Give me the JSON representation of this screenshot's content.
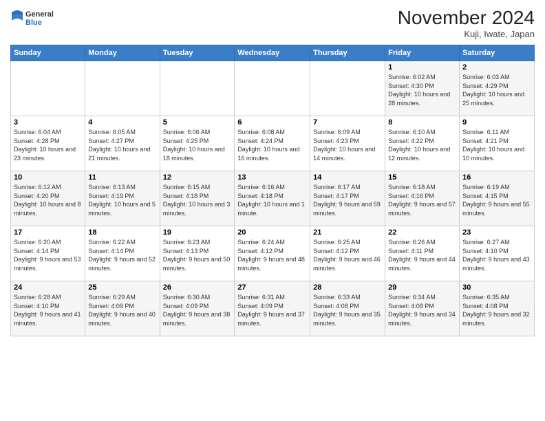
{
  "logo": {
    "general": "General",
    "blue": "Blue"
  },
  "header": {
    "title": "November 2024",
    "location": "Kuji, Iwate, Japan"
  },
  "days_of_week": [
    "Sunday",
    "Monday",
    "Tuesday",
    "Wednesday",
    "Thursday",
    "Friday",
    "Saturday"
  ],
  "weeks": [
    [
      {
        "day": "",
        "info": ""
      },
      {
        "day": "",
        "info": ""
      },
      {
        "day": "",
        "info": ""
      },
      {
        "day": "",
        "info": ""
      },
      {
        "day": "",
        "info": ""
      },
      {
        "day": "1",
        "info": "Sunrise: 6:02 AM\nSunset: 4:30 PM\nDaylight: 10 hours and 28 minutes."
      },
      {
        "day": "2",
        "info": "Sunrise: 6:03 AM\nSunset: 4:29 PM\nDaylight: 10 hours and 25 minutes."
      }
    ],
    [
      {
        "day": "3",
        "info": "Sunrise: 6:04 AM\nSunset: 4:28 PM\nDaylight: 10 hours and 23 minutes."
      },
      {
        "day": "4",
        "info": "Sunrise: 6:05 AM\nSunset: 4:27 PM\nDaylight: 10 hours and 21 minutes."
      },
      {
        "day": "5",
        "info": "Sunrise: 6:06 AM\nSunset: 4:25 PM\nDaylight: 10 hours and 18 minutes."
      },
      {
        "day": "6",
        "info": "Sunrise: 6:08 AM\nSunset: 4:24 PM\nDaylight: 10 hours and 16 minutes."
      },
      {
        "day": "7",
        "info": "Sunrise: 6:09 AM\nSunset: 4:23 PM\nDaylight: 10 hours and 14 minutes."
      },
      {
        "day": "8",
        "info": "Sunrise: 6:10 AM\nSunset: 4:22 PM\nDaylight: 10 hours and 12 minutes."
      },
      {
        "day": "9",
        "info": "Sunrise: 6:11 AM\nSunset: 4:21 PM\nDaylight: 10 hours and 10 minutes."
      }
    ],
    [
      {
        "day": "10",
        "info": "Sunrise: 6:12 AM\nSunset: 4:20 PM\nDaylight: 10 hours and 8 minutes."
      },
      {
        "day": "11",
        "info": "Sunrise: 6:13 AM\nSunset: 4:19 PM\nDaylight: 10 hours and 5 minutes."
      },
      {
        "day": "12",
        "info": "Sunrise: 6:15 AM\nSunset: 4:18 PM\nDaylight: 10 hours and 3 minutes."
      },
      {
        "day": "13",
        "info": "Sunrise: 6:16 AM\nSunset: 4:18 PM\nDaylight: 10 hours and 1 minute."
      },
      {
        "day": "14",
        "info": "Sunrise: 6:17 AM\nSunset: 4:17 PM\nDaylight: 9 hours and 59 minutes."
      },
      {
        "day": "15",
        "info": "Sunrise: 6:18 AM\nSunset: 4:16 PM\nDaylight: 9 hours and 57 minutes."
      },
      {
        "day": "16",
        "info": "Sunrise: 6:19 AM\nSunset: 4:15 PM\nDaylight: 9 hours and 55 minutes."
      }
    ],
    [
      {
        "day": "17",
        "info": "Sunrise: 6:20 AM\nSunset: 4:14 PM\nDaylight: 9 hours and 53 minutes."
      },
      {
        "day": "18",
        "info": "Sunrise: 6:22 AM\nSunset: 4:14 PM\nDaylight: 9 hours and 52 minutes."
      },
      {
        "day": "19",
        "info": "Sunrise: 6:23 AM\nSunset: 4:13 PM\nDaylight: 9 hours and 50 minutes."
      },
      {
        "day": "20",
        "info": "Sunrise: 6:24 AM\nSunset: 4:12 PM\nDaylight: 9 hours and 48 minutes."
      },
      {
        "day": "21",
        "info": "Sunrise: 6:25 AM\nSunset: 4:12 PM\nDaylight: 9 hours and 46 minutes."
      },
      {
        "day": "22",
        "info": "Sunrise: 6:26 AM\nSunset: 4:11 PM\nDaylight: 9 hours and 44 minutes."
      },
      {
        "day": "23",
        "info": "Sunrise: 6:27 AM\nSunset: 4:10 PM\nDaylight: 9 hours and 43 minutes."
      }
    ],
    [
      {
        "day": "24",
        "info": "Sunrise: 6:28 AM\nSunset: 4:10 PM\nDaylight: 9 hours and 41 minutes."
      },
      {
        "day": "25",
        "info": "Sunrise: 6:29 AM\nSunset: 4:09 PM\nDaylight: 9 hours and 40 minutes."
      },
      {
        "day": "26",
        "info": "Sunrise: 6:30 AM\nSunset: 4:09 PM\nDaylight: 9 hours and 38 minutes."
      },
      {
        "day": "27",
        "info": "Sunrise: 6:31 AM\nSunset: 4:09 PM\nDaylight: 9 hours and 37 minutes."
      },
      {
        "day": "28",
        "info": "Sunrise: 6:33 AM\nSunset: 4:08 PM\nDaylight: 9 hours and 35 minutes."
      },
      {
        "day": "29",
        "info": "Sunrise: 6:34 AM\nSunset: 4:08 PM\nDaylight: 9 hours and 34 minutes."
      },
      {
        "day": "30",
        "info": "Sunrise: 6:35 AM\nSunset: 4:08 PM\nDaylight: 9 hours and 32 minutes."
      }
    ]
  ]
}
